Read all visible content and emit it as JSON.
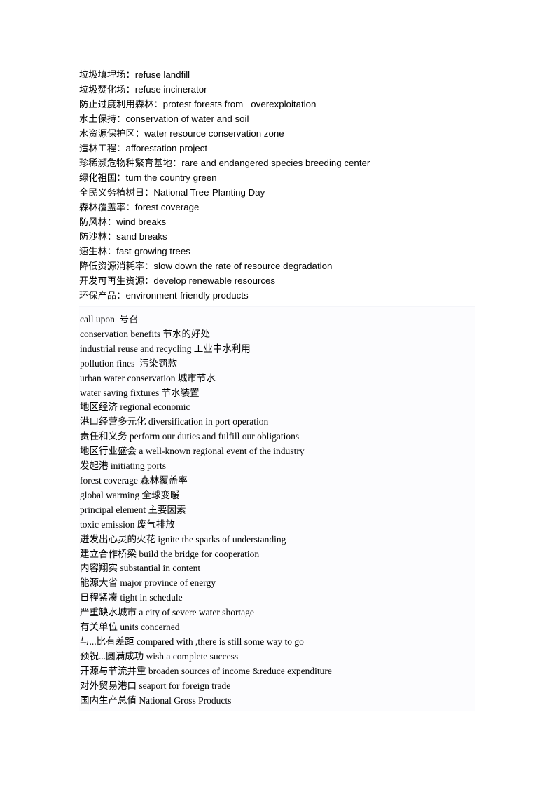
{
  "document": {
    "page_background": "#ffffff",
    "text_color": "#000000",
    "tint_color": "#fcfcfe",
    "section_one": {
      "name": "environment-glossary-sans",
      "lines": [
        "垃圾填埋场：refuse landfill",
        "垃圾焚化场：refuse incinerator",
        "防止过度利用森林：protest forests from   overexploitation",
        "水土保持：conservation of water and soil",
        "水资源保护区：water resource conservation zone",
        "造林工程：afforestation project",
        "珍稀濒危物种繁育基地：rare and endangered species breeding center",
        "绿化祖国：turn the country green",
        "全民义务植树日：National Tree-Planting Day",
        "森林覆盖率：forest coverage",
        "防风林：wind breaks",
        "防沙林：sand breaks",
        "速生林：fast-growing trees",
        "降低资源消耗率：slow down the rate of resource degradation",
        "开发可再生资源：develop renewable resources",
        "环保产品：environment-friendly products"
      ]
    },
    "section_two": {
      "name": "environment-glossary-serif",
      "lines": [
        "call upon  号召",
        "conservation benefits 节水的好处",
        "industrial reuse and recycling 工业中水利用",
        "pollution fines  污染罚款",
        "urban water conservation 城市节水",
        "water saving fixtures 节水装置",
        "地区经济 regional economic",
        "港口经营多元化 diversification in port operation",
        "责任和义务 perform our duties and fulfill our obligations",
        "地区行业盛会 a well-known regional event of the industry",
        "发起港 initiating ports",
        "forest coverage 森林覆盖率",
        "global warming 全球变暖",
        "principal element 主要因素",
        "toxic emission 废气排放",
        "迸发出心灵的火花 ignite the sparks of understanding",
        "建立合作桥梁 build the bridge for cooperation",
        "内容翔实 substantial in content",
        "能源大省 major province of energy",
        "日程紧凑 tight in schedule",
        "严重缺水城市 a city of severe water shortage",
        "有关单位 units concerned",
        "与...比有差距 compared with ,there is still some way to go",
        "预祝...圆满成功 wish a complete success",
        "开源与节流并重 broaden sources of income &reduce expenditure",
        "对外贸易港口 seaport for foreign trade",
        "国内生产总值 National Gross Products"
      ]
    }
  }
}
